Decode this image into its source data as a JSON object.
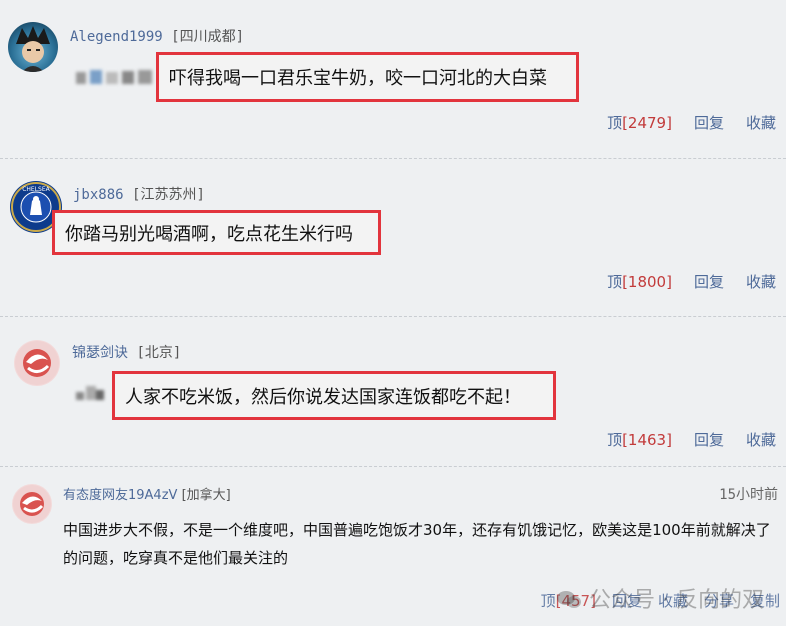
{
  "comments": [
    {
      "username": "Alegend1999",
      "location": "[四川成都]",
      "prefix": "​",
      "text": "吓得我喝一口君乐宝牛奶，咬一口河北的大白菜",
      "up": "顶",
      "up_count": "[2479]",
      "reply": "回复",
      "fav": "收藏"
    },
    {
      "username": "jbx886",
      "location": "[江苏苏州]",
      "text": "你踏马别光喝酒啊，吃点花生米行吗",
      "up": "顶",
      "up_count": "[1800]",
      "reply": "回复",
      "fav": "收藏",
      "avatar_text": "CHELSEA"
    },
    {
      "username": "锦瑟剑诀",
      "location": "[北京]",
      "text": "人家不吃米饭，然后你说发达国家连饭都吃不起！",
      "up": "顶",
      "up_count": "[1463]",
      "reply": "回复",
      "fav": "收藏"
    },
    {
      "username": "有态度网友19A4zV",
      "location": "[加拿大]",
      "time": "15小时前",
      "text": "中国进步大不假，不是一个维度吧，中国普遍吃饱饭才30年，还存有饥饿记忆，欧美这是100年前就解决了的问题，吃穿真不是他们最关注的",
      "up": "顶",
      "up_count": "[457]",
      "reply": "回复",
      "fav": "收藏",
      "share": "分享",
      "copy": "复制"
    }
  ],
  "watermark": "公众号 · 反向的双",
  "colors": {
    "highlight": "#e2343d",
    "link": "#4e6a99",
    "count": "#c23b3b"
  }
}
